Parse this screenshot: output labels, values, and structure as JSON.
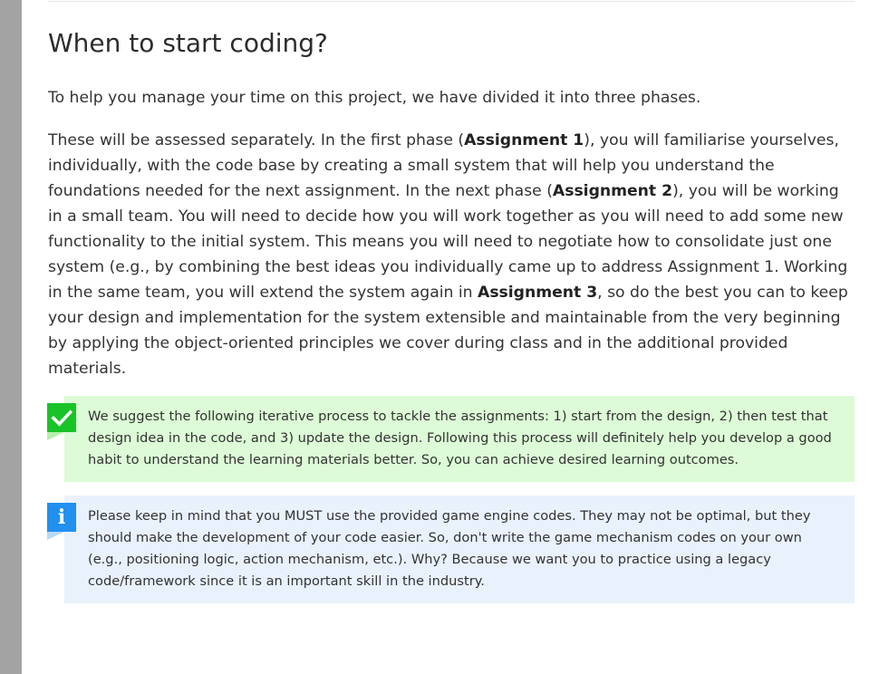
{
  "heading": "When to start coding?",
  "intro": "To help you manage your time on this project, we have divided it into three phases.",
  "body": {
    "t1": "These will be assessed separately. In the first phase (",
    "b1": "Assignment 1",
    "t2": "), you will familiarise yourselves, individually, with the code base by creating a small system that will help you understand the foundations needed for the next assignment. In the next phase  (",
    "b2": "Assignment 2",
    "t3": "), you will be working in a small team. You will need to decide how you will work together as you will need to add some new functionality to the initial system. This means you will need to negotiate how to consolidate just one system (e.g., by combining the best ideas you individually came up to address Assignment 1. Working in the same team, you will extend the system again in ",
    "b3": "Assignment 3",
    "t4": ", so do the best you can to keep your design and implementation for the system extensible and maintainable from the very beginning by applying the object-oriented principles we cover during class and in the additional provided materials."
  },
  "callouts": {
    "success": {
      "icon": "check-icon",
      "color": "#19c327",
      "background": "#dcfbd6",
      "text": "We suggest the following iterative process to tackle the assignments: 1) start from the design, 2) then test that design idea in the code, and 3) update the design. Following this process will definitely help you develop a good habit to understand the learning materials better. So, you can achieve desired learning outcomes."
    },
    "info": {
      "icon": "info-icon",
      "color": "#2190ee",
      "background": "#e9f1fd",
      "glyph": "i",
      "text": "Please keep in mind that you MUST use the provided game engine codes. They may not be optimal, but they should make the development of your code easier. So, don't write the game mechanism codes on your own (e.g., positioning logic, action mechanism, etc.). Why? Because we want you to practice using a legacy code/framework since it is an important skill in the industry."
    }
  }
}
